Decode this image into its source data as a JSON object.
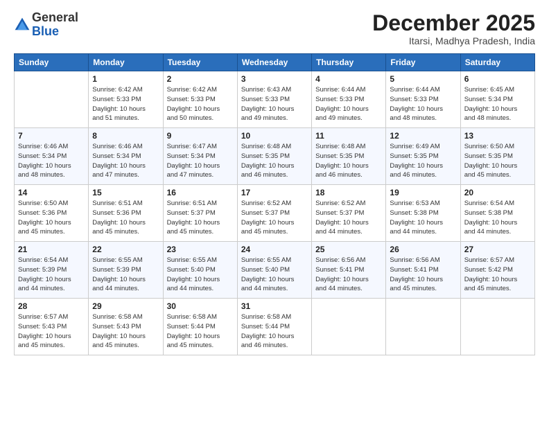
{
  "header": {
    "logo_line1": "General",
    "logo_line2": "Blue",
    "month_title": "December 2025",
    "location": "Itarsi, Madhya Pradesh, India"
  },
  "weekdays": [
    "Sunday",
    "Monday",
    "Tuesday",
    "Wednesday",
    "Thursday",
    "Friday",
    "Saturday"
  ],
  "weeks": [
    [
      {
        "day": "",
        "info": ""
      },
      {
        "day": "1",
        "info": "Sunrise: 6:42 AM\nSunset: 5:33 PM\nDaylight: 10 hours\nand 51 minutes."
      },
      {
        "day": "2",
        "info": "Sunrise: 6:42 AM\nSunset: 5:33 PM\nDaylight: 10 hours\nand 50 minutes."
      },
      {
        "day": "3",
        "info": "Sunrise: 6:43 AM\nSunset: 5:33 PM\nDaylight: 10 hours\nand 49 minutes."
      },
      {
        "day": "4",
        "info": "Sunrise: 6:44 AM\nSunset: 5:33 PM\nDaylight: 10 hours\nand 49 minutes."
      },
      {
        "day": "5",
        "info": "Sunrise: 6:44 AM\nSunset: 5:33 PM\nDaylight: 10 hours\nand 48 minutes."
      },
      {
        "day": "6",
        "info": "Sunrise: 6:45 AM\nSunset: 5:34 PM\nDaylight: 10 hours\nand 48 minutes."
      }
    ],
    [
      {
        "day": "7",
        "info": "Sunrise: 6:46 AM\nSunset: 5:34 PM\nDaylight: 10 hours\nand 48 minutes."
      },
      {
        "day": "8",
        "info": "Sunrise: 6:46 AM\nSunset: 5:34 PM\nDaylight: 10 hours\nand 47 minutes."
      },
      {
        "day": "9",
        "info": "Sunrise: 6:47 AM\nSunset: 5:34 PM\nDaylight: 10 hours\nand 47 minutes."
      },
      {
        "day": "10",
        "info": "Sunrise: 6:48 AM\nSunset: 5:35 PM\nDaylight: 10 hours\nand 46 minutes."
      },
      {
        "day": "11",
        "info": "Sunrise: 6:48 AM\nSunset: 5:35 PM\nDaylight: 10 hours\nand 46 minutes."
      },
      {
        "day": "12",
        "info": "Sunrise: 6:49 AM\nSunset: 5:35 PM\nDaylight: 10 hours\nand 46 minutes."
      },
      {
        "day": "13",
        "info": "Sunrise: 6:50 AM\nSunset: 5:35 PM\nDaylight: 10 hours\nand 45 minutes."
      }
    ],
    [
      {
        "day": "14",
        "info": "Sunrise: 6:50 AM\nSunset: 5:36 PM\nDaylight: 10 hours\nand 45 minutes."
      },
      {
        "day": "15",
        "info": "Sunrise: 6:51 AM\nSunset: 5:36 PM\nDaylight: 10 hours\nand 45 minutes."
      },
      {
        "day": "16",
        "info": "Sunrise: 6:51 AM\nSunset: 5:37 PM\nDaylight: 10 hours\nand 45 minutes."
      },
      {
        "day": "17",
        "info": "Sunrise: 6:52 AM\nSunset: 5:37 PM\nDaylight: 10 hours\nand 45 minutes."
      },
      {
        "day": "18",
        "info": "Sunrise: 6:52 AM\nSunset: 5:37 PM\nDaylight: 10 hours\nand 44 minutes."
      },
      {
        "day": "19",
        "info": "Sunrise: 6:53 AM\nSunset: 5:38 PM\nDaylight: 10 hours\nand 44 minutes."
      },
      {
        "day": "20",
        "info": "Sunrise: 6:54 AM\nSunset: 5:38 PM\nDaylight: 10 hours\nand 44 minutes."
      }
    ],
    [
      {
        "day": "21",
        "info": "Sunrise: 6:54 AM\nSunset: 5:39 PM\nDaylight: 10 hours\nand 44 minutes."
      },
      {
        "day": "22",
        "info": "Sunrise: 6:55 AM\nSunset: 5:39 PM\nDaylight: 10 hours\nand 44 minutes."
      },
      {
        "day": "23",
        "info": "Sunrise: 6:55 AM\nSunset: 5:40 PM\nDaylight: 10 hours\nand 44 minutes."
      },
      {
        "day": "24",
        "info": "Sunrise: 6:55 AM\nSunset: 5:40 PM\nDaylight: 10 hours\nand 44 minutes."
      },
      {
        "day": "25",
        "info": "Sunrise: 6:56 AM\nSunset: 5:41 PM\nDaylight: 10 hours\nand 44 minutes."
      },
      {
        "day": "26",
        "info": "Sunrise: 6:56 AM\nSunset: 5:41 PM\nDaylight: 10 hours\nand 45 minutes."
      },
      {
        "day": "27",
        "info": "Sunrise: 6:57 AM\nSunset: 5:42 PM\nDaylight: 10 hours\nand 45 minutes."
      }
    ],
    [
      {
        "day": "28",
        "info": "Sunrise: 6:57 AM\nSunset: 5:43 PM\nDaylight: 10 hours\nand 45 minutes."
      },
      {
        "day": "29",
        "info": "Sunrise: 6:58 AM\nSunset: 5:43 PM\nDaylight: 10 hours\nand 45 minutes."
      },
      {
        "day": "30",
        "info": "Sunrise: 6:58 AM\nSunset: 5:44 PM\nDaylight: 10 hours\nand 45 minutes."
      },
      {
        "day": "31",
        "info": "Sunrise: 6:58 AM\nSunset: 5:44 PM\nDaylight: 10 hours\nand 46 minutes."
      },
      {
        "day": "",
        "info": ""
      },
      {
        "day": "",
        "info": ""
      },
      {
        "day": "",
        "info": ""
      }
    ]
  ]
}
